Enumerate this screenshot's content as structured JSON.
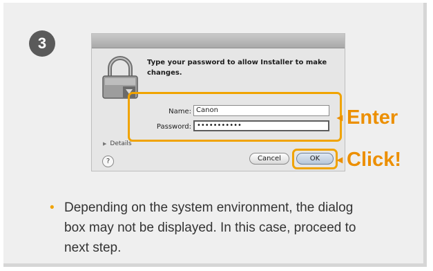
{
  "step": {
    "number": "3"
  },
  "dialog": {
    "prompt": "Type your password to allow Installer to make changes.",
    "name_label": "Name:",
    "name_value": "Canon",
    "password_label": "Password:",
    "password_value": "•••••••••••",
    "details_label": "Details",
    "help_label": "?",
    "cancel_label": "Cancel",
    "ok_label": "OK"
  },
  "callouts": {
    "enter_label": "Enter",
    "click_label": "Click!",
    "arrow_glyph": "◂"
  },
  "note": {
    "bullet": "•",
    "text": "Depending on the system environment, the dialog box may not be displayed. In this case, proceed to next step."
  },
  "colors": {
    "accent": "#f0a300",
    "callout_text": "#ec8f00",
    "badge": "#5a5a5a",
    "card_bg": "#efefef"
  },
  "icons": {
    "lock": "lock-icon",
    "details_toggle": "disclosure-triangle-icon",
    "help": "help-icon",
    "callout_arrow": "arrow-left-icon"
  }
}
